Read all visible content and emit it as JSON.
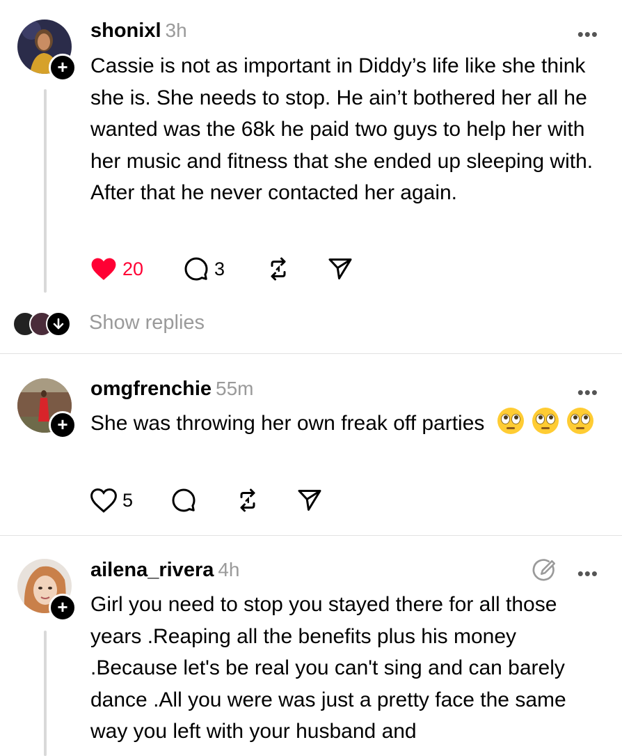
{
  "posts": [
    {
      "username": "shonixl",
      "time": "3h",
      "more": "•••",
      "text": "Cassie is not as important in Diddy’s life like she think she is. She needs to stop. He ain’t bothered her all he wanted was the 68k he paid two guys to help her with her music and fitness that she ended up sleeping with. After that he never contacted her again.",
      "likes": "20",
      "replies": "3",
      "liked": true,
      "show_replies": "Show replies"
    },
    {
      "username": "omgfrenchie",
      "time": "55m",
      "more": "•••",
      "text": "She was throwing her own freak off parties",
      "likes": "5",
      "liked": false
    },
    {
      "username": "ailena_rivera",
      "time": "4h",
      "more": "•••",
      "text": "Girl you need to stop you stayed there for all those years .Reaping all the benefits plus his money .Because let's be real you can't sing and can barely dance .All you were was just a pretty face the same way you left with your husband and"
    }
  ],
  "icons": {
    "heart_filled": "heart-filled-icon",
    "heart": "heart-icon",
    "comment": "comment-icon",
    "repost": "repost-icon",
    "share": "send-icon",
    "edited": "edited-icon",
    "follow": "plus-icon",
    "show_replies": "chevron-down-icon"
  },
  "colors": {
    "like": "#ff0034",
    "muted": "#9a9a9a",
    "text": "#000000"
  }
}
